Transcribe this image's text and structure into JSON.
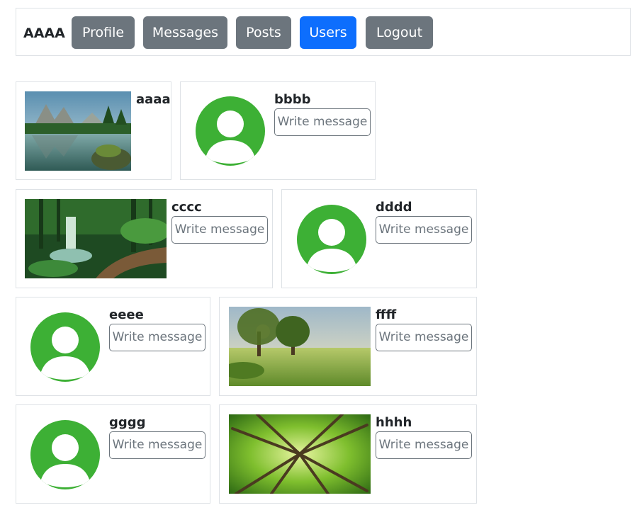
{
  "nav": {
    "brand": "AAAA",
    "items": [
      {
        "label": "Profile",
        "color": "#6c757d"
      },
      {
        "label": "Messages",
        "color": "#6c757d"
      },
      {
        "label": "Posts",
        "color": "#6c757d"
      },
      {
        "label": "Users",
        "color": "#0d6efd",
        "active": true
      },
      {
        "label": "Logout",
        "color": "#6c757d"
      }
    ]
  },
  "colors": {
    "avatar": "#3db035",
    "border": "#dee2e6",
    "outline_button": "#6c757d"
  },
  "users": [
    {
      "name": "aaaa",
      "image": "mountain-lake-photo"
    },
    {
      "name": "bbbb",
      "image": "default-avatar-icon",
      "action": "Write message"
    },
    {
      "name": "cccc",
      "image": "forest-waterfall-photo",
      "action": "Write message"
    },
    {
      "name": "dddd",
      "image": "default-avatar-icon",
      "action": "Write message"
    },
    {
      "name": "eeee",
      "image": "default-avatar-icon",
      "action": "Write message"
    },
    {
      "name": "ffff",
      "image": "meadow-trees-photo",
      "action": "Write message"
    },
    {
      "name": "gggg",
      "image": "default-avatar-icon",
      "action": "Write message"
    },
    {
      "name": "hhhh",
      "image": "tree-canopy-photo",
      "action": "Write message"
    }
  ]
}
